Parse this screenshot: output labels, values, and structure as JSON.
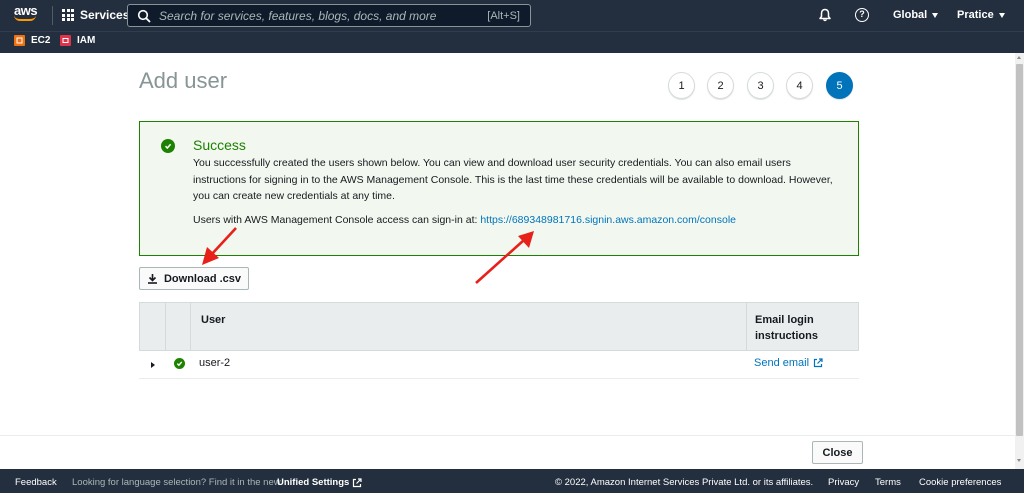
{
  "topnav": {
    "logo_text": "aws",
    "services_label": "Services",
    "search_placeholder": "Search for services, features, blogs, docs, and more",
    "search_shortcut": "[Alt+S]",
    "region_label": "Global",
    "account_label": "Pratice"
  },
  "favorites": [
    {
      "label": "EC2",
      "icon": "ec2-icon",
      "color": "#ec7211"
    },
    {
      "label": "IAM",
      "icon": "iam-icon",
      "color": "#dd344c"
    }
  ],
  "page": {
    "title": "Add user",
    "steps": [
      "1",
      "2",
      "3",
      "4",
      "5"
    ],
    "active_step": "5"
  },
  "success": {
    "title": "Success",
    "body": "You successfully created the users shown below. You can view and download user security credentials. You can also email users instructions for signing in to the AWS Management Console. This is the last time these credentials will be available to download. However, you can create new credentials at any time.",
    "signin_prefix": "Users with AWS Management Console access can sign-in at:",
    "signin_url": "https://689348981716.signin.aws.amazon.com/console"
  },
  "download_button": "Download .csv",
  "table": {
    "headers": {
      "user": "User",
      "email": "Email login instructions"
    },
    "rows": [
      {
        "user": "user-2",
        "action": "Send email"
      }
    ]
  },
  "close_button": "Close",
  "footer": {
    "feedback": "Feedback",
    "language_prefix": "Looking for language selection? Find it in the new",
    "unified_settings": "Unified Settings",
    "copyright": "© 2022, Amazon Internet Services Private Ltd. or its affiliates.",
    "privacy": "Privacy",
    "terms": "Terms",
    "cookie": "Cookie preferences"
  },
  "colors": {
    "nav_bg": "#232f3e",
    "success_green": "#1d8102",
    "link_blue": "#0073bb",
    "annotation_red": "#e8201a"
  }
}
